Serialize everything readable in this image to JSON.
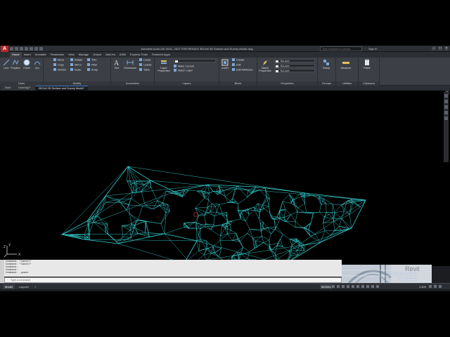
{
  "app": {
    "title": "Autodesk AutoCAD 2016 - NOT FOR RESALE  3DCivil 3D Surface and Survey Model.dwg",
    "search_placeholder": "Type a keyword or phrase",
    "sign_in": "Sign In"
  },
  "ribbon_tabs": [
    "Home",
    "Insert",
    "Annotate",
    "Parametric",
    "View",
    "Manage",
    "Output",
    "Add-ins",
    "A360",
    "Express Tools",
    "Featured Apps"
  ],
  "ribbon": {
    "draw": {
      "label": "Draw",
      "line": "Line",
      "polyline": "Polyline",
      "circle": "Circle",
      "arc": "Arc"
    },
    "modify": {
      "label": "Modify",
      "move": "Move",
      "copy": "Copy",
      "stretch": "Stretch",
      "rotate": "Rotate",
      "mirror": "Mirror",
      "scale": "Scale",
      "trim": "Trim",
      "fillet": "Fillet",
      "array": "Array"
    },
    "annotation": {
      "label": "Annotation",
      "text": "Text",
      "dimension": "Dimension",
      "linear": "Linear",
      "leader": "Leader",
      "table": "Table"
    },
    "layers": {
      "label": "Layers",
      "layer_properties": "Layer Properties",
      "make_current": "Make Current",
      "match_layer": "Match Layer"
    },
    "block": {
      "label": "Block",
      "insert": "Insert",
      "create": "Create",
      "edit": "Edit",
      "edit_attributes": "Edit Attributes"
    },
    "properties": {
      "label": "Properties",
      "match_properties": "Match Properties",
      "color": "ByLayer",
      "linetype": "ByLayer",
      "lineweight": "ByLayer"
    },
    "groups": {
      "label": "Groups",
      "group": "Group"
    },
    "utilities": {
      "label": "Utilities",
      "measure": "Measure"
    },
    "clipboard": {
      "label": "Clipboard",
      "paste": "Paste"
    }
  },
  "file_tabs": [
    "Start",
    "Drawing1*",
    "3DCivil 3D Surface and Survey Model*"
  ],
  "command_history": [
    "Command: *Cancel*",
    "Command: *Cancel*",
    "Command:",
    "Command:",
    "Command: _qsave"
  ],
  "command_placeholder": "Type a command",
  "watermark": {
    "title": "Revit",
    "line1": "A Structured",
    "line2": "Approach"
  },
  "status": {
    "layout_tabs": [
      "Model",
      "Layout1"
    ],
    "model_label": "MODEL",
    "scale": "1:400"
  },
  "colors": {
    "mesh": "#35d3d3",
    "canvas": "#000000",
    "ribbon": "#3c4046",
    "logo": "#b8262b"
  }
}
